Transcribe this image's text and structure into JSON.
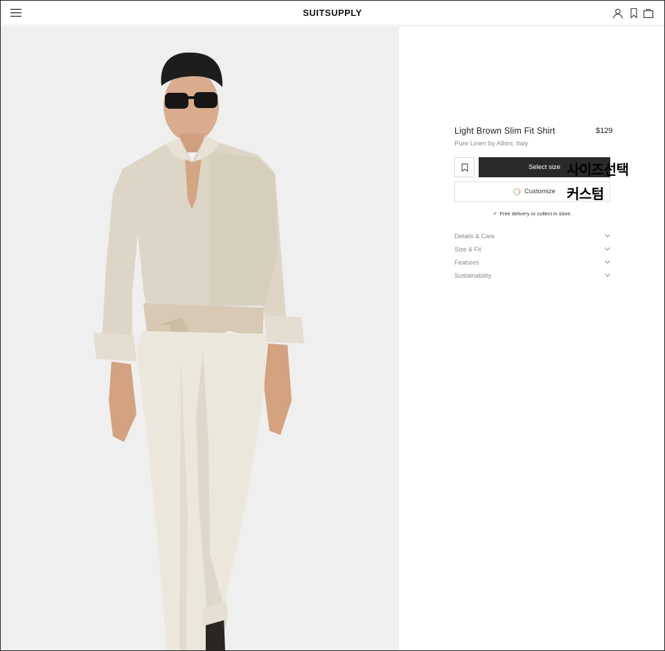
{
  "header": {
    "logo": "SUITSUPPLY",
    "icons": [
      "menu-icon",
      "account-icon",
      "bookmark-icon",
      "bag-icon"
    ]
  },
  "product": {
    "title": "Light Brown Slim Fit Shirt",
    "price": "$129",
    "subtitle": "Pure Linen by Albini, Italy",
    "select_size_label": "Select size",
    "customize_label": "Customize",
    "delivery_note": "Free delivery or collect in store."
  },
  "annotations": {
    "select_size": "사이즈선택",
    "customize": "커스텀"
  },
  "accordion": [
    {
      "label": "Details & Care"
    },
    {
      "label": "Size & Fit"
    },
    {
      "label": "Features"
    },
    {
      "label": "Sustainability"
    }
  ],
  "colors": {
    "primary_button": "#2a2a2a",
    "image_background": "#efefef"
  }
}
